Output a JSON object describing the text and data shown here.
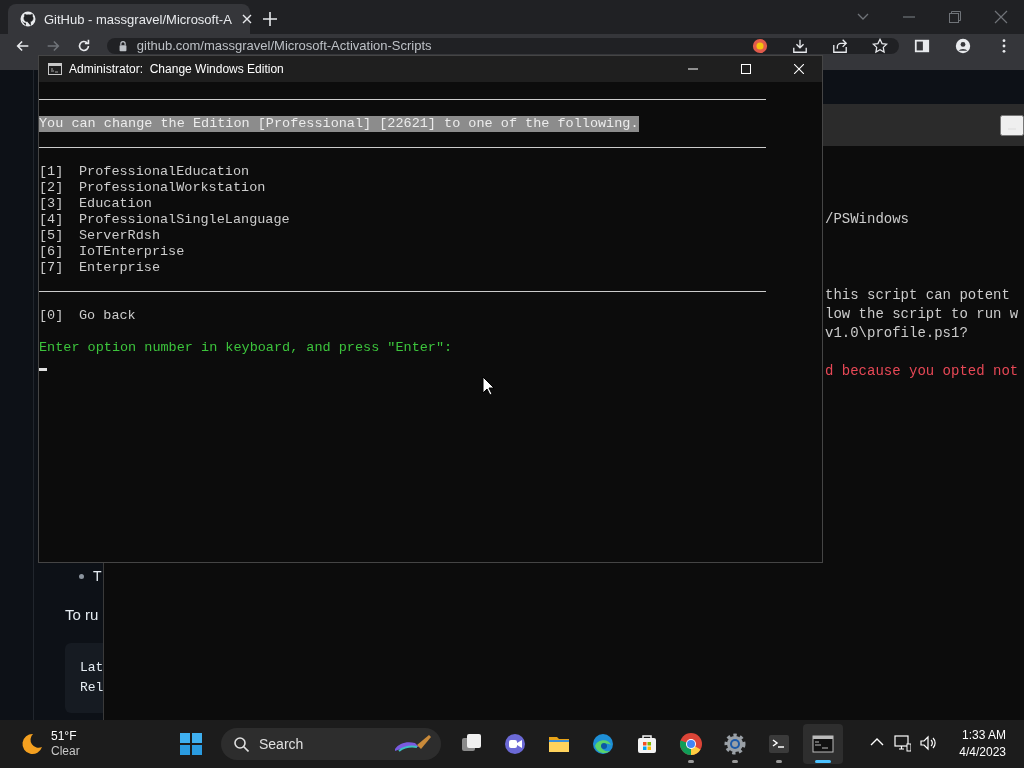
{
  "browser": {
    "tabs": [
      {
        "title": "GitHub - massgravel/Microsoft-A",
        "selected": true
      }
    ],
    "address": "github.com/massgravel/Microsoft-Activation-Scripts",
    "page": {
      "list_item": "T",
      "paragraph": "To ru",
      "code_lines": [
        "Lat",
        "Rel"
      ]
    }
  },
  "terminal": {
    "lines": [
      {
        "kind": "text",
        "text": "/PSWindows"
      },
      {
        "kind": "blank"
      },
      {
        "kind": "blank"
      },
      {
        "kind": "blank"
      },
      {
        "kind": "text",
        "text": "this script can potent"
      },
      {
        "kind": "text",
        "text": "low the script to run w"
      },
      {
        "kind": "text",
        "text": "v1.0\\profile.ps1?"
      },
      {
        "kind": "blank"
      },
      {
        "kind": "error",
        "text": "d because you opted not"
      }
    ]
  },
  "console": {
    "title": "Administrator:  Change Windows Edition",
    "lines": [
      {
        "kind": "rule"
      },
      {
        "kind": "blank"
      },
      {
        "kind": "highlight",
        "text": "You can change the Edition [Professional] [22621] to one of the following."
      },
      {
        "kind": "rule"
      },
      {
        "kind": "blank"
      },
      {
        "kind": "option",
        "key": "[1]",
        "label": "ProfessionalEducation"
      },
      {
        "kind": "option",
        "key": "[2]",
        "label": "ProfessionalWorkstation"
      },
      {
        "kind": "option",
        "key": "[3]",
        "label": "Education"
      },
      {
        "kind": "option",
        "key": "[4]",
        "label": "ProfessionalSingleLanguage"
      },
      {
        "kind": "option",
        "key": "[5]",
        "label": "ServerRdsh"
      },
      {
        "kind": "option",
        "key": "[6]",
        "label": "IoTEnterprise"
      },
      {
        "kind": "option",
        "key": "[7]",
        "label": "Enterprise"
      },
      {
        "kind": "rule"
      },
      {
        "kind": "blank"
      },
      {
        "kind": "option",
        "key": "[0]",
        "label": "Go back"
      },
      {
        "kind": "blank"
      },
      {
        "kind": "prompt",
        "text": "Enter option number in keyboard, and press \"Enter\":"
      },
      {
        "kind": "cursor"
      }
    ]
  },
  "taskbar": {
    "weather": {
      "temperature": "51°F",
      "condition": "Clear"
    },
    "search": {
      "label": "Search"
    },
    "apps": [
      {
        "kind": "taskview",
        "running": false,
        "selected": false
      },
      {
        "kind": "chat",
        "running": false,
        "selected": false
      },
      {
        "kind": "explorer",
        "running": false,
        "selected": false
      },
      {
        "kind": "edge",
        "running": false,
        "selected": false
      },
      {
        "kind": "store",
        "running": false,
        "selected": false
      },
      {
        "kind": "chrome",
        "running": true,
        "selected": false
      },
      {
        "kind": "settings",
        "running": true,
        "selected": false
      },
      {
        "kind": "terminal",
        "running": true,
        "selected": false
      },
      {
        "kind": "console",
        "running": true,
        "selected": true
      }
    ],
    "clock": {
      "time": "1:33 AM",
      "date": "4/4/2023"
    }
  }
}
